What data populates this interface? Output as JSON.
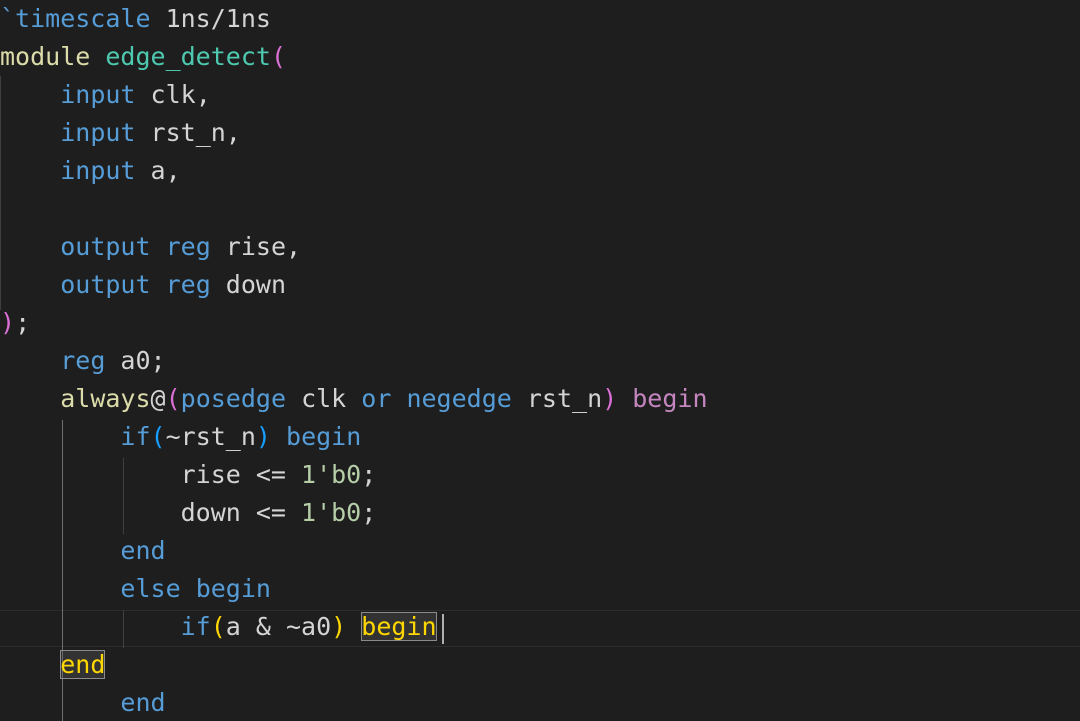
{
  "colors": {
    "background": "#1e1e1e",
    "text": "#d4d4d4",
    "keyword_blue": "#569cd6",
    "keyword_yellow": "#dcdcaa",
    "control_purple": "#c586c0",
    "identifier": "#d4d4d4",
    "module_name": "#4ec9b0",
    "number": "#b5cea8",
    "bracket_gold": "#ffd700",
    "bracket_purple": "#da70d6",
    "bracket_blue": "#179fff"
  },
  "lines": [
    [
      {
        "t": "`timescale",
        "c": "keyword_blue"
      },
      {
        "t": " 1ns/1ns",
        "c": "text"
      }
    ],
    [
      {
        "t": "module",
        "c": "keyword_yellow"
      },
      {
        "t": " ",
        "c": "text"
      },
      {
        "t": "edge_detect",
        "c": "module_name"
      },
      {
        "t": "(",
        "c": "bracket_purple"
      }
    ],
    [
      {
        "t": "    ",
        "c": "text"
      },
      {
        "t": "input",
        "c": "keyword_blue"
      },
      {
        "t": " clk,",
        "c": "text"
      }
    ],
    [
      {
        "t": "    ",
        "c": "text"
      },
      {
        "t": "input",
        "c": "keyword_blue"
      },
      {
        "t": " rst_n,",
        "c": "text"
      }
    ],
    [
      {
        "t": "    ",
        "c": "text"
      },
      {
        "t": "input",
        "c": "keyword_blue"
      },
      {
        "t": " a,",
        "c": "text"
      }
    ],
    [],
    [
      {
        "t": "    ",
        "c": "text"
      },
      {
        "t": "output",
        "c": "keyword_blue"
      },
      {
        "t": " ",
        "c": "text"
      },
      {
        "t": "reg",
        "c": "keyword_blue"
      },
      {
        "t": " rise,",
        "c": "text"
      }
    ],
    [
      {
        "t": "    ",
        "c": "text"
      },
      {
        "t": "output",
        "c": "keyword_blue"
      },
      {
        "t": " ",
        "c": "text"
      },
      {
        "t": "reg",
        "c": "keyword_blue"
      },
      {
        "t": " down",
        "c": "text"
      }
    ],
    [
      {
        "t": ")",
        "c": "bracket_purple"
      },
      {
        "t": ";",
        "c": "text"
      }
    ],
    [
      {
        "t": "    ",
        "c": "text"
      },
      {
        "t": "reg",
        "c": "keyword_blue"
      },
      {
        "t": " a0;",
        "c": "text"
      }
    ],
    [
      {
        "t": "    ",
        "c": "text"
      },
      {
        "t": "always",
        "c": "keyword_yellow"
      },
      {
        "t": "@",
        "c": "text"
      },
      {
        "t": "(",
        "c": "bracket_purple"
      },
      {
        "t": "posedge",
        "c": "keyword_blue"
      },
      {
        "t": " clk ",
        "c": "text"
      },
      {
        "t": "or",
        "c": "keyword_blue"
      },
      {
        "t": " ",
        "c": "text"
      },
      {
        "t": "negedge",
        "c": "keyword_blue"
      },
      {
        "t": " rst_n",
        "c": "text"
      },
      {
        "t": ")",
        "c": "bracket_purple"
      },
      {
        "t": " ",
        "c": "text"
      },
      {
        "t": "begin",
        "c": "control_purple"
      }
    ],
    [
      {
        "t": "        ",
        "c": "text"
      },
      {
        "t": "if",
        "c": "keyword_blue"
      },
      {
        "t": "(",
        "c": "bracket_blue"
      },
      {
        "t": "~rst_n",
        "c": "text"
      },
      {
        "t": ")",
        "c": "bracket_blue"
      },
      {
        "t": " ",
        "c": "text"
      },
      {
        "t": "begin",
        "c": "keyword_blue"
      }
    ],
    [
      {
        "t": "            rise <= ",
        "c": "text"
      },
      {
        "t": "1'b0",
        "c": "number"
      },
      {
        "t": ";",
        "c": "text"
      }
    ],
    [
      {
        "t": "            down <= ",
        "c": "text"
      },
      {
        "t": "1'b0",
        "c": "number"
      },
      {
        "t": ";",
        "c": "text"
      }
    ],
    [
      {
        "t": "        ",
        "c": "text"
      },
      {
        "t": "end",
        "c": "keyword_blue"
      }
    ],
    [
      {
        "t": "        ",
        "c": "text"
      },
      {
        "t": "else",
        "c": "keyword_blue"
      },
      {
        "t": " ",
        "c": "text"
      },
      {
        "t": "begin",
        "c": "keyword_blue"
      }
    ],
    [
      {
        "t": "            ",
        "c": "text"
      },
      {
        "t": "if",
        "c": "keyword_blue"
      },
      {
        "t": "(",
        "c": "bracket_gold"
      },
      {
        "t": "a & ~a0",
        "c": "text"
      },
      {
        "t": ")",
        "c": "bracket_gold"
      },
      {
        "t": " ",
        "c": "text"
      },
      {
        "t": "begin",
        "c": "bracket_gold",
        "m": true
      }
    ],
    [
      {
        "t": "    ",
        "c": "text"
      },
      {
        "t": "end",
        "c": "bracket_gold",
        "m": true
      }
    ],
    [
      {
        "t": "        ",
        "c": "text"
      },
      {
        "t": "end",
        "c": "keyword_blue"
      }
    ]
  ]
}
